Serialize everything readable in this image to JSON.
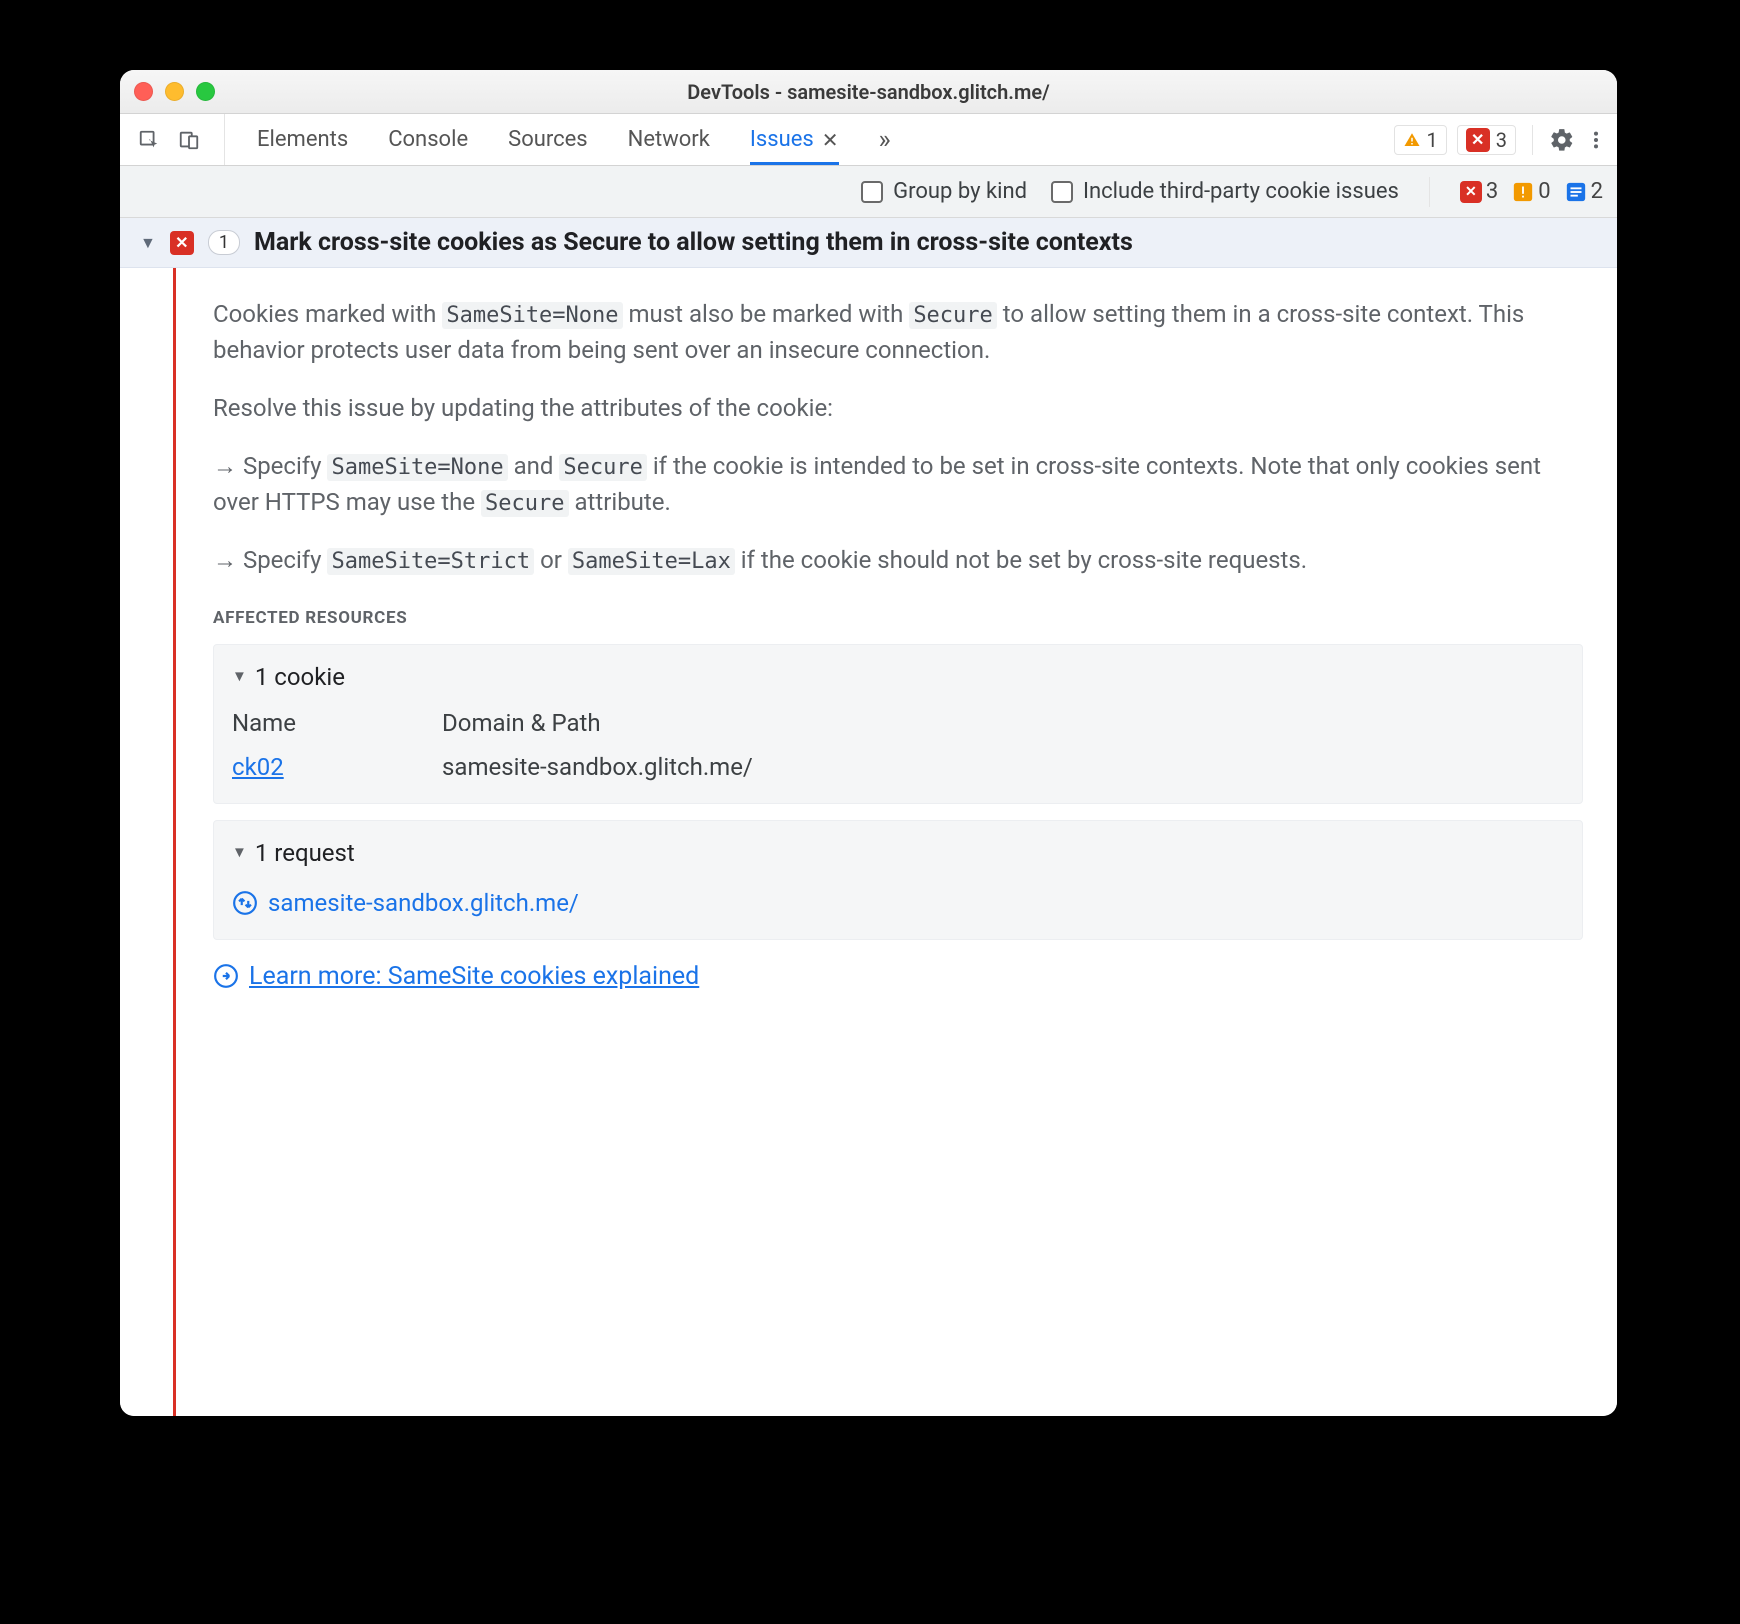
{
  "window": {
    "title": "DevTools - samesite-sandbox.glitch.me/"
  },
  "tabs": {
    "items": [
      "Elements",
      "Console",
      "Sources",
      "Network",
      "Issues"
    ],
    "active_index": 4
  },
  "toolbar_badges": {
    "warning_count": "1",
    "error_count": "3"
  },
  "filterbar": {
    "group_by_kind": "Group by kind",
    "include_third_party": "Include third-party cookie issues",
    "counts": {
      "errors": "3",
      "warnings": "0",
      "info": "2"
    }
  },
  "issue": {
    "count": "1",
    "title": "Mark cross-site cookies as Secure to allow setting them in cross-site contexts",
    "body": {
      "p1_a": "Cookies marked with ",
      "c1": "SameSite=None",
      "p1_b": " must also be marked with ",
      "c2": "Secure",
      "p1_c": " to allow setting them in a cross-site context. This behavior protects user data from being sent over an insecure connection.",
      "p2": "Resolve this issue by updating the attributes of the cookie:",
      "b1_a": "Specify ",
      "b1_c1": "SameSite=None",
      "b1_b": " and ",
      "b1_c2": "Secure",
      "b1_c": " if the cookie is intended to be set in cross-site contexts. Note that only cookies sent over HTTPS may use the ",
      "b1_c3": "Secure",
      "b1_d": " attribute.",
      "b2_a": "Specify ",
      "b2_c1": "SameSite=Strict",
      "b2_b": " or ",
      "b2_c2": "SameSite=Lax",
      "b2_c": " if the cookie should not be set by cross-site requests."
    },
    "affected": {
      "label": "AFFECTED RESOURCES",
      "cookies": {
        "header": "1 cookie",
        "cols": {
          "name": "Name",
          "domain": "Domain & Path"
        },
        "rows": [
          {
            "name": "ck02",
            "domain": "samesite-sandbox.glitch.me/"
          }
        ]
      },
      "requests": {
        "header": "1 request",
        "rows": [
          {
            "url": "samesite-sandbox.glitch.me/"
          }
        ]
      }
    },
    "learn_more": "Learn more: SameSite cookies explained"
  }
}
